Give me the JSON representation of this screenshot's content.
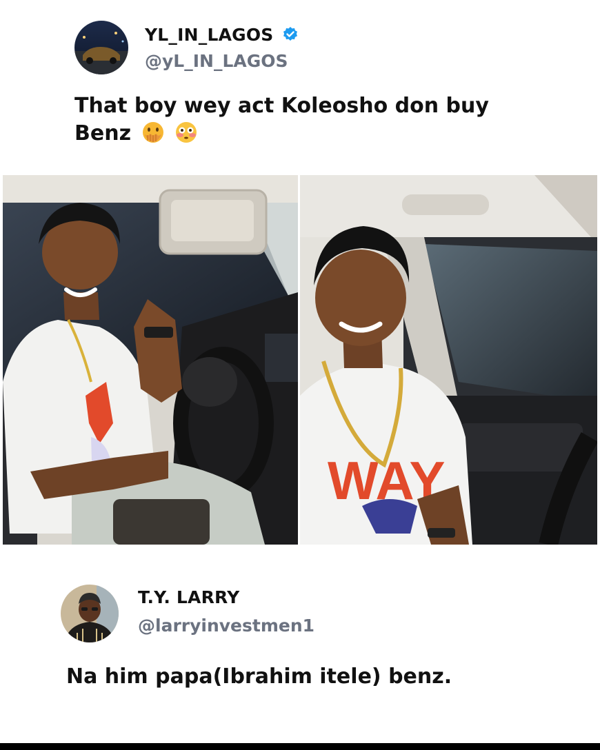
{
  "tweet": {
    "author": {
      "name": "YL_IN_LAGOS",
      "handle": "@yL_IN_LAGOS",
      "verified": true,
      "avatar_icon": "car-night-avatar"
    },
    "text": "That boy wey act Koleosho don buy Benz",
    "text_line1": "That boy wey act Koleosho don buy",
    "text_line2": "Benz",
    "emojis": [
      "face-with-hand-over-mouth-emoji",
      "flushed-face-emoji"
    ],
    "photos": [
      {
        "name": "photo-left",
        "description_icon": "boy-in-car-photo"
      },
      {
        "name": "photo-right",
        "description_icon": "boy-in-car-photo"
      }
    ]
  },
  "reply": {
    "author": {
      "name": "T.Y. LARRY",
      "handle": "@larryinvestmen1",
      "avatar_icon": "man-with-cap-avatar"
    },
    "text": "Na him papa(Ibrahim itele) benz."
  },
  "colors": {
    "verified_badge": "#1d9bf0",
    "handle": "#6b7280",
    "text": "#111111"
  }
}
